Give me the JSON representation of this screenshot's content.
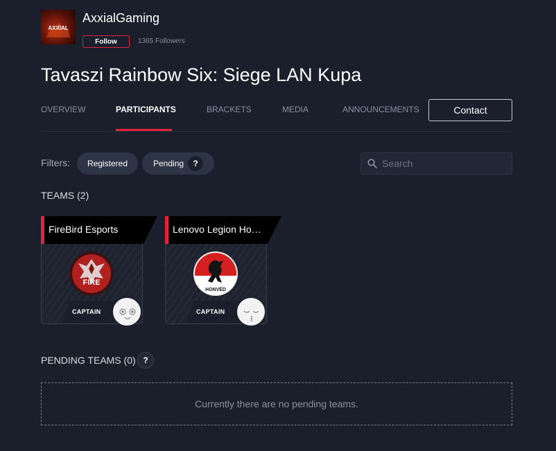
{
  "organizer": {
    "name": "AxxialGaming",
    "follow_label": "Follow",
    "followers": "1365 Followers",
    "logo_text": "AXXIAL"
  },
  "page_title": "Tavaszi Rainbow Six: Siege LAN Kupa",
  "tabs": [
    {
      "label": "OVERVIEW",
      "active": false
    },
    {
      "label": "PARTICIPANTS",
      "active": true
    },
    {
      "label": "BRACKETS",
      "active": false
    },
    {
      "label": "MEDIA",
      "active": false
    },
    {
      "label": "ANNOUNCEMENTS",
      "active": false
    }
  ],
  "contact_label": "Contact",
  "filters": {
    "label": "Filters:",
    "registered": "Registered",
    "pending": "Pending",
    "pending_help": "?"
  },
  "search": {
    "placeholder": "Search"
  },
  "teams": {
    "heading": "TEAMS (2)",
    "items": [
      {
        "name": "FireBird Esports",
        "logo_text": "FIRE",
        "role": "CAPTAIN"
      },
      {
        "name": "Lenovo Legion Honvéd",
        "logo_text": "HONVÉD",
        "role": "CAPTAIN"
      }
    ]
  },
  "pending_teams": {
    "heading": "PENDING TEAMS (0)",
    "help": "?",
    "empty_message": "Currently there are no pending teams."
  },
  "colors": {
    "background": "#1b1f2b",
    "accent": "#e3223d",
    "chip": "#2d3446",
    "muted_text": "#8a90a0"
  }
}
